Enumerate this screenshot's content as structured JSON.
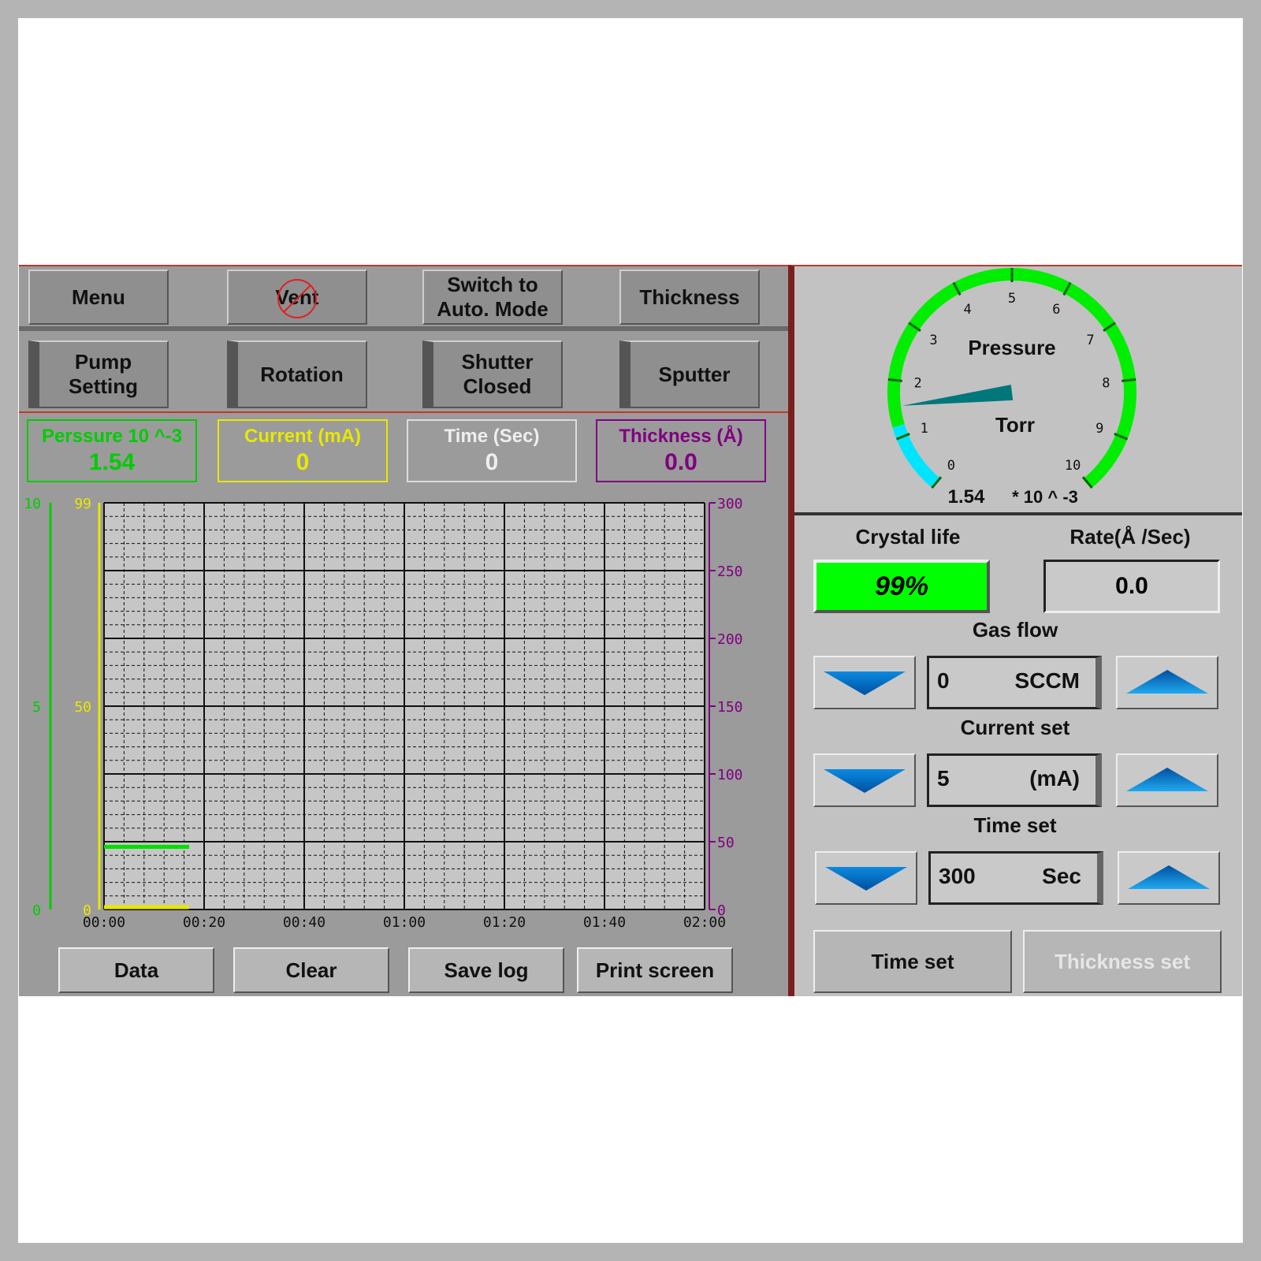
{
  "top_buttons": {
    "menu": "Menu",
    "vent": "Vent",
    "auto_mode": "Switch to\nAuto. Mode",
    "thickness": "Thickness"
  },
  "second_buttons": {
    "pump": "Pump\nSetting",
    "rotation": "Rotation",
    "shutter": "Shutter\nClosed",
    "sputter": "Sputter"
  },
  "readouts": {
    "pressure": {
      "label": "Perssure 10 ^-3",
      "value": "1.54"
    },
    "current": {
      "label": "Current (mA)",
      "value": "0"
    },
    "time": {
      "label": "Time (Sec)",
      "value": "0"
    },
    "thickness": {
      "label": "Thickness (Å)",
      "value": "0.0"
    }
  },
  "chart_data": {
    "type": "line",
    "x_ticks": [
      "00:00",
      "00:20",
      "00:40",
      "01:00",
      "01:20",
      "01:40",
      "02:00"
    ],
    "y_pressure_ticks": [
      "10",
      "5",
      "0"
    ],
    "y_current_ticks": [
      "99",
      "50",
      "0"
    ],
    "y_thickness_ticks": [
      "300",
      "250",
      "200",
      "150",
      "100",
      "50",
      "0"
    ],
    "series": [
      {
        "axis": "pressure",
        "color": "#00e000",
        "x": [
          0,
          17
        ],
        "y": [
          1.54,
          1.54
        ]
      },
      {
        "axis": "current",
        "color": "#e8e800",
        "x": [
          0,
          17
        ],
        "y": [
          0,
          0
        ]
      }
    ],
    "xlim": [
      0,
      120
    ],
    "ylim_pressure": [
      0,
      10
    ],
    "ylim_current": [
      0,
      99
    ],
    "ylim_thickness": [
      0,
      300
    ],
    "grid": true
  },
  "bottom_buttons": {
    "data": "Data",
    "clear": "Clear",
    "save": "Save log",
    "print": "Print screen"
  },
  "gauge": {
    "title": "Pressure",
    "unit": "Torr",
    "reading": "1.54",
    "exponent": "* 10 ^ -3",
    "ticks": [
      "0",
      "1",
      "2",
      "3",
      "4",
      "5",
      "6",
      "7",
      "8",
      "9",
      "10"
    ],
    "value": 1.54,
    "min": 0,
    "max": 10
  },
  "crystal_life": {
    "label": "Crystal life",
    "value": "99%",
    "color": "#00ff00"
  },
  "rate": {
    "label": "Rate(Å /Sec)",
    "value": "0.0"
  },
  "gas_flow": {
    "label": "Gas flow",
    "value": "0",
    "unit": "SCCM"
  },
  "current_set": {
    "label": "Current set",
    "value": "5",
    "unit": "(mA)"
  },
  "time_setting": {
    "label": "Time set",
    "value": "300",
    "unit": "Sec"
  },
  "action_buttons": {
    "time_set": "Time set",
    "thickness_set": "Thickness set"
  },
  "colors": {
    "pressure": "#00cc00",
    "current": "#e8e800",
    "time": "#dddddd",
    "thickness": "#800080",
    "gauge_green": "#00ee00",
    "gauge_cyan": "#00e5ff",
    "needle": "#00777a"
  }
}
